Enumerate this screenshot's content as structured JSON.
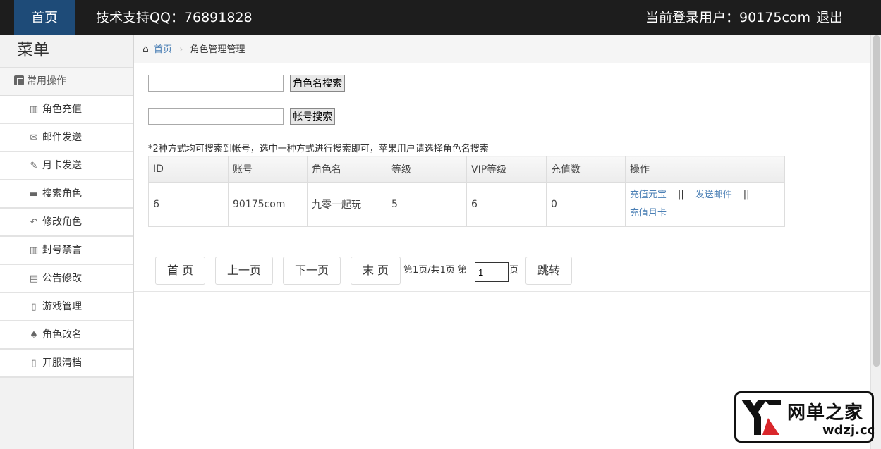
{
  "topbar": {
    "home": "首页",
    "support": "技术支持QQ：76891828",
    "current_user": "当前登录用户：90175com",
    "logout": "退出"
  },
  "sidebar": {
    "title": "菜单",
    "group": "常用操作",
    "items": [
      {
        "label": "角色充值",
        "icon": "books-icon"
      },
      {
        "label": "邮件发送",
        "icon": "envelope-icon"
      },
      {
        "label": "月卡发送",
        "icon": "pen-icon"
      },
      {
        "label": "搜索角色",
        "icon": "folder-icon"
      },
      {
        "label": "修改角色",
        "icon": "reply-icon"
      },
      {
        "label": "封号禁言",
        "icon": "books-icon"
      },
      {
        "label": "公告修改",
        "icon": "list-icon"
      },
      {
        "label": "游戏管理",
        "icon": "file-icon"
      },
      {
        "label": "角色改名",
        "icon": "spade-icon"
      },
      {
        "label": "开服清档",
        "icon": "file-icon"
      }
    ]
  },
  "breadcrumb": {
    "home": "首页",
    "current": "角色管理管理"
  },
  "search": {
    "role_button": "角色名搜索",
    "account_button": "帐号搜索",
    "note": "*2种方式均可搜索到帐号，选中一种方式进行搜索即可，苹果用户请选择角色名搜索"
  },
  "table": {
    "headers": [
      "ID",
      "账号",
      "角色名",
      "等级",
      "VIP等级",
      "充值数",
      "操作"
    ],
    "rows": [
      {
        "cells": [
          "6",
          "90175com",
          "九零一起玩",
          "5",
          "6",
          "0"
        ],
        "actions": {
          "recharge_yuanbao": "充值元宝",
          "send_mail": "发送邮件",
          "recharge_monthly": "充值月卡",
          "separator": "||"
        }
      }
    ]
  },
  "pager": {
    "first": "首 页",
    "prev": "上一页",
    "next": "下一页",
    "last": "末 页",
    "info_prefix": "第1页/共1页 第",
    "page_value": "1",
    "info_suffix": "页",
    "go": "跳转"
  },
  "watermark": {
    "cn": "网单之家",
    "en": "wdzj.cc"
  }
}
